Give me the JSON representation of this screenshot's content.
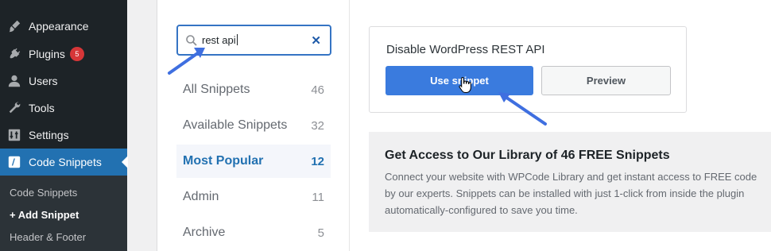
{
  "sidebar": {
    "items": [
      {
        "label": "Appearance",
        "icon": "paintbrush-icon"
      },
      {
        "label": "Plugins",
        "icon": "plug-icon",
        "badge": "5"
      },
      {
        "label": "Users",
        "icon": "user-icon"
      },
      {
        "label": "Tools",
        "icon": "wrench-icon"
      },
      {
        "label": "Settings",
        "icon": "sliders-icon"
      },
      {
        "label": "Code Snippets",
        "icon": "code-icon"
      }
    ],
    "submenu": [
      "Code Snippets",
      "+ Add Snippet",
      "Header & Footer"
    ]
  },
  "search": {
    "value": "rest api",
    "clear_icon": "✕"
  },
  "categories": [
    {
      "label": "All Snippets",
      "count": "46"
    },
    {
      "label": "Available Snippets",
      "count": "32"
    },
    {
      "label": "Most Popular",
      "count": "12"
    },
    {
      "label": "Admin",
      "count": "11"
    },
    {
      "label": "Archive",
      "count": "5"
    }
  ],
  "snippet": {
    "title": "Disable WordPress REST API",
    "use_label": "Use snippet",
    "preview_label": "Preview"
  },
  "library": {
    "title": "Get Access to Our Library of 46 FREE Snippets",
    "lines": [
      "Connect your website with WPCode Library and get instant access to FREE code",
      "by our experts. Snippets can be installed with just 1-click from inside the plugin",
      "automatically-configured to save you time."
    ]
  },
  "colors": {
    "accent": "#2271b1",
    "button": "#3a7bde",
    "badge": "#d63638",
    "arrow": "#3f6fe0"
  }
}
